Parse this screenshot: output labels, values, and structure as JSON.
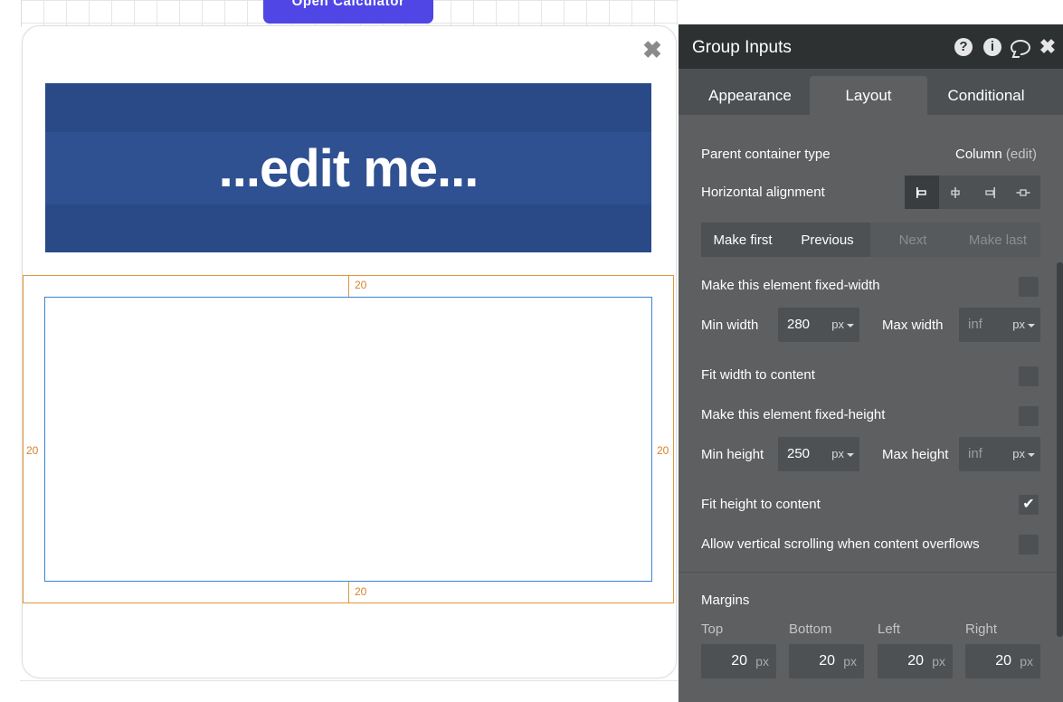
{
  "canvas": {
    "open_button": "Open Calculator",
    "banner_text": "...edit me...",
    "margins": {
      "top": "20",
      "bottom": "20",
      "left": "20",
      "right": "20"
    },
    "close_icon": "close-icon"
  },
  "panel": {
    "title": "Group Inputs",
    "header_icons": [
      "help-icon",
      "info-icon",
      "comment-icon",
      "close-icon"
    ],
    "tabs": [
      "Appearance",
      "Layout",
      "Conditional"
    ],
    "active_tab": "Layout",
    "parent_container": {
      "label": "Parent container type",
      "value": "Column",
      "edit": "(edit)"
    },
    "horizontal_alignment": {
      "label": "Horizontal alignment",
      "options": [
        "align-left",
        "align-center",
        "align-right",
        "align-distribute"
      ],
      "selected": "align-left"
    },
    "order_buttons": {
      "make_first": "Make first",
      "previous": "Previous",
      "next": "Next",
      "make_last": "Make last"
    },
    "fixed_width": {
      "label": "Make this element fixed-width",
      "checked": false
    },
    "min_width": {
      "label": "Min width",
      "value": "280",
      "unit": "px"
    },
    "max_width": {
      "label": "Max width",
      "placeholder": "inf",
      "unit": "px"
    },
    "fit_width": {
      "label": "Fit width to content",
      "checked": false
    },
    "fixed_height": {
      "label": "Make this element fixed-height",
      "checked": false
    },
    "min_height": {
      "label": "Min height",
      "value": "250",
      "unit": "px"
    },
    "max_height": {
      "label": "Max height",
      "placeholder": "inf",
      "unit": "px"
    },
    "fit_height": {
      "label": "Fit height to content",
      "checked": true,
      "mark": "✔"
    },
    "vertical_scroll": {
      "label": "Allow vertical scrolling when content overflows",
      "checked": false
    },
    "margins_section": {
      "title": "Margins",
      "labels": [
        "Top",
        "Bottom",
        "Left",
        "Right"
      ],
      "values": [
        "20",
        "20",
        "20",
        "20"
      ],
      "unit": "px"
    }
  }
}
